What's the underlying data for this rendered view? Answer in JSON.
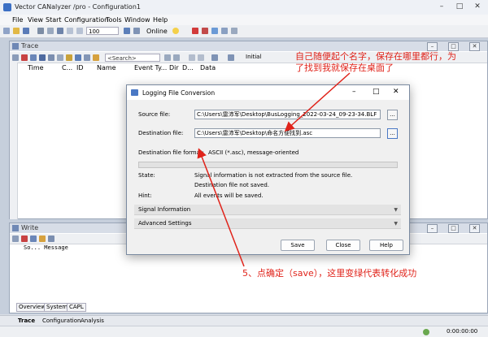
{
  "window": {
    "title": "Vector CANalyzer /pro - Configuration1",
    "minimize": "–",
    "maximize": "□",
    "close": "✕"
  },
  "menu": [
    "File",
    "View",
    "Start",
    "Configuration",
    "Tools",
    "Window",
    "Help"
  ],
  "toolbar": {
    "zoom_value": "100",
    "online_label": "Online"
  },
  "trace": {
    "title": "Trace",
    "search_placeholder": "<Search>",
    "mode_label": "Initial",
    "columns": [
      "Time",
      "C...",
      "ID",
      "Name",
      "Event Ty...",
      "Dir",
      "D...",
      "Data"
    ]
  },
  "write": {
    "title": "Write",
    "columns": "So... Message",
    "tabs": [
      "Overview",
      "System",
      "CAPL"
    ]
  },
  "bottom_tabs": [
    "Trace",
    "Configuration",
    "Analysis"
  ],
  "status": {
    "time": "0:00:00:00"
  },
  "dialog": {
    "title": "Logging File Conversion",
    "source_label": "Source file:",
    "source_value": "C:\\Users\\雷沛军\\Desktop\\BusLogging_2022-03-24_09-23-34.BLF",
    "browse_label": "...",
    "destination_label": "Destination file:",
    "destination_value": "C:\\Users\\雷沛军\\Desktop\\命名方便找到.asc",
    "format_label": "Destination file format:",
    "format_value": "ASCII (*.asc), message-oriented",
    "progress": 0,
    "state_label": "State:",
    "state_line1": "Signal information is not extracted from the source file.",
    "state_line2": "Destination file not saved.",
    "hint_label": "Hint:",
    "hint_value": "All events will be saved.",
    "section_signal": "Signal Information",
    "section_advanced": "Advanced Settings",
    "save_label": "Save",
    "close_label": "Close",
    "help_label": "Help"
  },
  "annotations": {
    "top_note": "自己随便起个名字，保存在哪里都行，为了找到我就保存在桌面了",
    "bottom_note": "5、点确定（save），这里变绿代表转化成功",
    "color": "#e0231a"
  }
}
